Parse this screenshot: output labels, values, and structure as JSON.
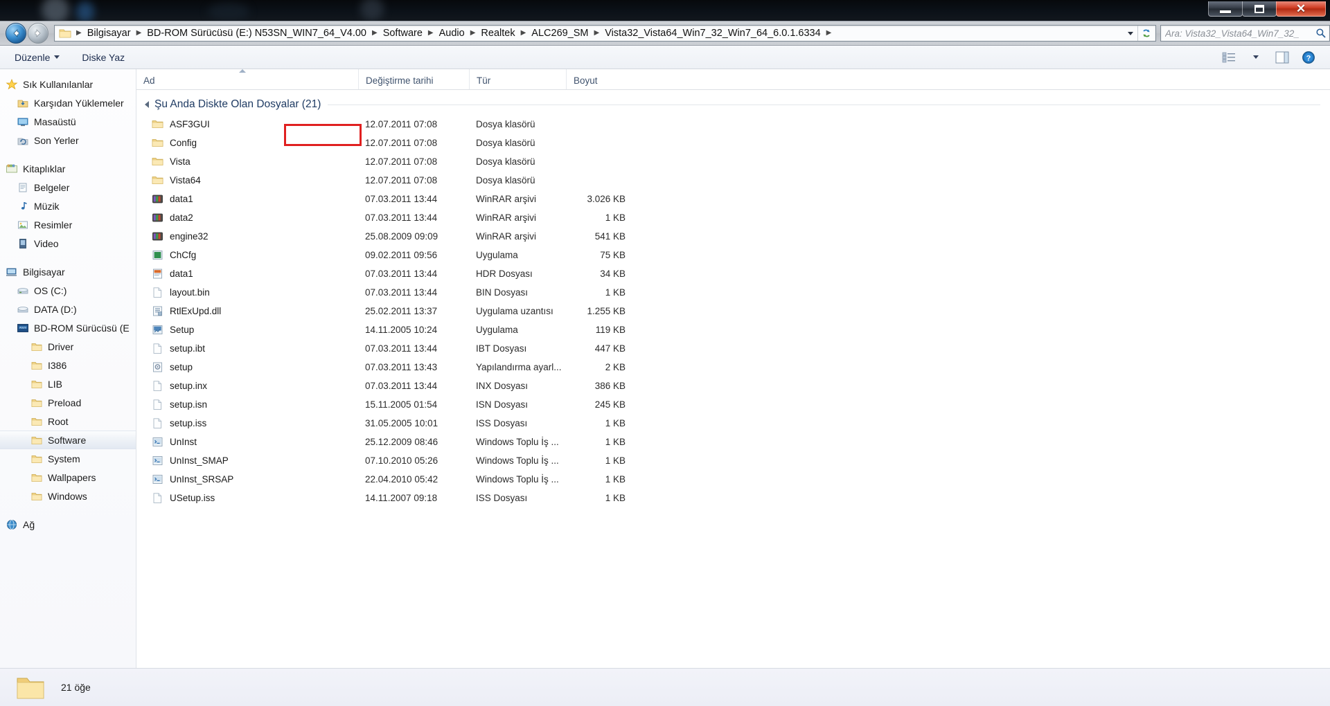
{
  "window": {
    "controls": {
      "minimize_label": "Simge Durumuna Küçült",
      "maximize_label": "Ekranı Kapla",
      "close_label": "Kapat",
      "close_glyph": "✕"
    }
  },
  "address_bar": {
    "back_label": "Geri",
    "forward_label": "İleri",
    "breadcrumbs": [
      "Bilgisayar",
      "BD-ROM Sürücüsü (E:) N53SN_WIN7_64_V4.00",
      "Software",
      "Audio",
      "Realtek",
      "ALC269_SM",
      "Vista32_Vista64_Win7_32_Win7_64_6.0.1.6334"
    ],
    "separator": "▶",
    "dropdown_icon": "chevron-down-icon",
    "refresh_icon": "refresh-icon"
  },
  "search": {
    "value": "Ara: Vista32_Vista64_Win7_32_",
    "icon": "search-icon"
  },
  "toolbar": {
    "organize_label": "Düzenle",
    "burn_label": "Diske Yaz",
    "view_icon": "view-list-icon",
    "preview_icon": "preview-pane-icon",
    "help_icon": "help-icon",
    "help_glyph": "?"
  },
  "nav_pane": {
    "groups": [
      {
        "header": {
          "label": "Sık Kullanılanlar",
          "icon": "favorites-star-icon",
          "indent": 0
        },
        "items": [
          {
            "label": "Karşıdan Yüklemeler",
            "icon": "downloads-icon",
            "indent": 1
          },
          {
            "label": "Masaüstü",
            "icon": "desktop-icon",
            "indent": 1
          },
          {
            "label": "Son Yerler",
            "icon": "recent-places-icon",
            "indent": 1
          }
        ]
      },
      {
        "header": {
          "label": "Kitaplıklar",
          "icon": "libraries-icon",
          "indent": 0
        },
        "items": [
          {
            "label": "Belgeler",
            "icon": "documents-icon",
            "indent": 1
          },
          {
            "label": "Müzik",
            "icon": "music-icon",
            "indent": 1
          },
          {
            "label": "Resimler",
            "icon": "pictures-icon",
            "indent": 1
          },
          {
            "label": "Video",
            "icon": "video-icon",
            "indent": 1
          }
        ]
      },
      {
        "header": {
          "label": "Bilgisayar",
          "icon": "computer-icon",
          "indent": 0
        },
        "items": [
          {
            "label": "OS (C:)",
            "icon": "hard-drive-icon",
            "indent": 1
          },
          {
            "label": "DATA (D:)",
            "icon": "hard-drive-icon",
            "indent": 1
          },
          {
            "label": "BD-ROM Sürücüsü (E",
            "icon": "optical-drive-icon",
            "indent": 1
          },
          {
            "label": "Driver",
            "icon": "folder-icon",
            "indent": 2
          },
          {
            "label": "I386",
            "icon": "folder-icon",
            "indent": 2
          },
          {
            "label": "LIB",
            "icon": "folder-icon",
            "indent": 2
          },
          {
            "label": "Preload",
            "icon": "folder-icon",
            "indent": 2
          },
          {
            "label": "Root",
            "icon": "folder-icon",
            "indent": 2
          },
          {
            "label": "Software",
            "icon": "folder-icon",
            "indent": 2,
            "selected": true
          },
          {
            "label": "System",
            "icon": "folder-icon",
            "indent": 2
          },
          {
            "label": "Wallpapers",
            "icon": "folder-icon",
            "indent": 2
          },
          {
            "label": "Windows",
            "icon": "folder-icon",
            "indent": 2
          }
        ]
      },
      {
        "header": {
          "label": "Ağ",
          "icon": "network-icon",
          "indent": 0
        },
        "items": []
      }
    ]
  },
  "file_list": {
    "columns": [
      {
        "key": "name",
        "label": "Ad",
        "sorted": true
      },
      {
        "key": "date",
        "label": "Değiştirme tarihi"
      },
      {
        "key": "type",
        "label": "Tür"
      },
      {
        "key": "size",
        "label": "Boyut"
      }
    ],
    "group_header": "Şu Anda Diskte Olan Dosyalar (21)",
    "highlighted_row": "ASF3GUI",
    "highlight_color": "#e02020",
    "rows": [
      {
        "name": "ASF3GUI",
        "date": "12.07.2011 07:08",
        "type": "Dosya klasörü",
        "size": "",
        "icon": "folder-icon"
      },
      {
        "name": "Config",
        "date": "12.07.2011 07:08",
        "type": "Dosya klasörü",
        "size": "",
        "icon": "folder-icon"
      },
      {
        "name": "Vista",
        "date": "12.07.2011 07:08",
        "type": "Dosya klasörü",
        "size": "",
        "icon": "folder-icon"
      },
      {
        "name": "Vista64",
        "date": "12.07.2011 07:08",
        "type": "Dosya klasörü",
        "size": "",
        "icon": "folder-icon"
      },
      {
        "name": "data1",
        "date": "07.03.2011 13:44",
        "type": "WinRAR arşivi",
        "size": "3.026 KB",
        "icon": "winrar-icon"
      },
      {
        "name": "data2",
        "date": "07.03.2011 13:44",
        "type": "WinRAR arşivi",
        "size": "1 KB",
        "icon": "winrar-icon"
      },
      {
        "name": "engine32",
        "date": "25.08.2009 09:09",
        "type": "WinRAR arşivi",
        "size": "541 KB",
        "icon": "winrar-icon"
      },
      {
        "name": "ChCfg",
        "date": "09.02.2011 09:56",
        "type": "Uygulama",
        "size": "75 KB",
        "icon": "application-icon"
      },
      {
        "name": "data1",
        "date": "07.03.2011 13:44",
        "type": "HDR Dosyası",
        "size": "34 KB",
        "icon": "hdr-file-icon"
      },
      {
        "name": "layout.bin",
        "date": "07.03.2011 13:44",
        "type": "BIN Dosyası",
        "size": "1 KB",
        "icon": "generic-file-icon"
      },
      {
        "name": "RtlExUpd.dll",
        "date": "25.02.2011 13:37",
        "type": "Uygulama uzantısı",
        "size": "1.255 KB",
        "icon": "dll-file-icon"
      },
      {
        "name": "Setup",
        "date": "14.11.2005 10:24",
        "type": "Uygulama",
        "size": "119 KB",
        "icon": "setup-icon"
      },
      {
        "name": "setup.ibt",
        "date": "07.03.2011 13:44",
        "type": "IBT Dosyası",
        "size": "447 KB",
        "icon": "generic-file-icon"
      },
      {
        "name": "setup",
        "date": "07.03.2011 13:43",
        "type": "Yapılandırma ayarl...",
        "size": "2 KB",
        "icon": "config-file-icon"
      },
      {
        "name": "setup.inx",
        "date": "07.03.2011 13:44",
        "type": "INX Dosyası",
        "size": "386 KB",
        "icon": "generic-file-icon"
      },
      {
        "name": "setup.isn",
        "date": "15.11.2005 01:54",
        "type": "ISN Dosyası",
        "size": "245 KB",
        "icon": "generic-file-icon"
      },
      {
        "name": "setup.iss",
        "date": "31.05.2005 10:01",
        "type": "ISS Dosyası",
        "size": "1 KB",
        "icon": "generic-file-icon"
      },
      {
        "name": "UnInst",
        "date": "25.12.2009 08:46",
        "type": "Windows Toplu İş ...",
        "size": "1 KB",
        "icon": "batch-file-icon"
      },
      {
        "name": "UnInst_SMAP",
        "date": "07.10.2010 05:26",
        "type": "Windows Toplu İş ...",
        "size": "1 KB",
        "icon": "batch-file-icon"
      },
      {
        "name": "UnInst_SRSAP",
        "date": "22.04.2010 05:42",
        "type": "Windows Toplu İş ...",
        "size": "1 KB",
        "icon": "batch-file-icon"
      },
      {
        "name": "USetup.iss",
        "date": "14.11.2007 09:18",
        "type": "ISS Dosyası",
        "size": "1 KB",
        "icon": "generic-file-icon"
      }
    ]
  },
  "status_bar": {
    "item_count": "21 öğe",
    "icon": "folder-large-icon"
  }
}
